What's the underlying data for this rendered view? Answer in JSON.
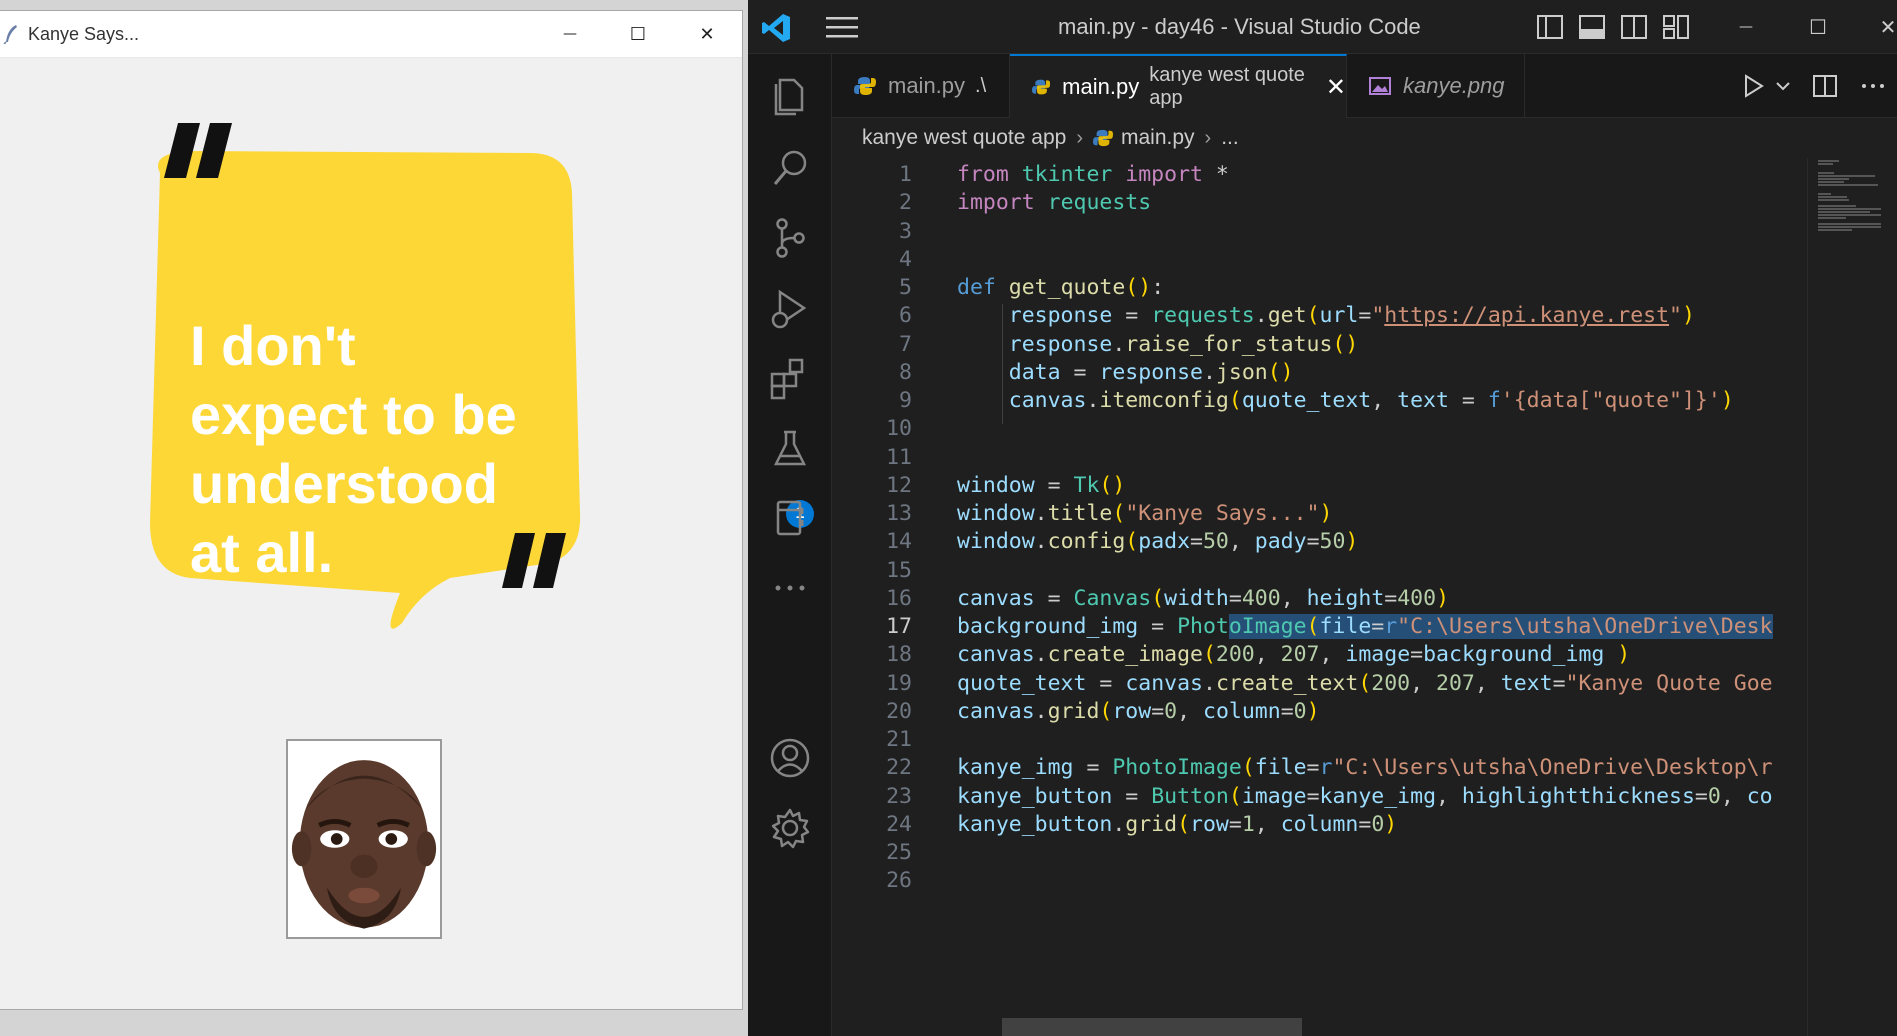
{
  "tk_window": {
    "title": "Kanye Says...",
    "controls": {
      "minimize": "—",
      "maximize": "☐",
      "close": "✕"
    },
    "quote_lines": [
      "I don't",
      "expect to be",
      "understood",
      "at all."
    ],
    "bubble_color": "#fdd736"
  },
  "vscode": {
    "window_title": "main.py - day46 - Visual Studio Code",
    "tabs": [
      {
        "label": "main.py",
        "description": ".\\"
      },
      {
        "label": "main.py",
        "description": "kanye west quote app",
        "active": true
      },
      {
        "label": "kanye.png",
        "description": ""
      }
    ],
    "breadcrumb": [
      "kanye west quote app",
      "main.py",
      "..."
    ],
    "extensions_badge": "1",
    "accent": "#0078d4",
    "code_lines": [
      "from tkinter import *",
      "import requests",
      "",
      "",
      "def get_quote():",
      "    response = requests.get(url=\"https://api.kanye.rest\")",
      "    response.raise_for_status()",
      "    data = response.json()",
      "    canvas.itemconfig(quote_text, text = f'{data[\"quote\"]}')",
      "",
      "",
      "window = Tk()",
      "window.title(\"Kanye Says...\")",
      "window.config(padx=50, pady=50)",
      "",
      "canvas = Canvas(width=400, height=400)",
      "background_img = PhotoImage(file=r\"C:\\Users\\utsha\\OneDrive\\Desk",
      "canvas.create_image(200, 207, image=background_img )",
      "quote_text = canvas.create_text(200, 207, text=\"Kanye Quote Goe",
      "canvas.grid(row=0, column=0)",
      "",
      "kanye_img = PhotoImage(file=r\"C:\\Users\\utsha\\OneDrive\\Desktop\\r",
      "kanye_button = Button(image=kanye_img, highlightthickness=0, co",
      "kanye_button.grid(row=1, column=0)",
      "",
      ""
    ],
    "line_numbers": [
      "1",
      "2",
      "3",
      "4",
      "5",
      "6",
      "7",
      "8",
      "9",
      "10",
      "11",
      "12",
      "13",
      "14",
      "15",
      "16",
      "17",
      "18",
      "19",
      "20",
      "21",
      "22",
      "23",
      "24",
      "25",
      "26"
    ],
    "current_line": 17
  }
}
